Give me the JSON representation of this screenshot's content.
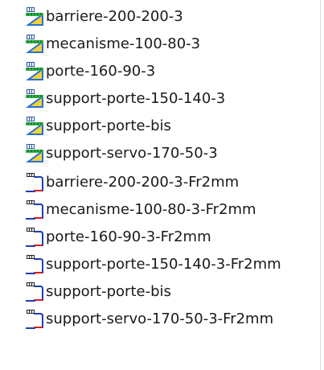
{
  "file_list": {
    "items": [
      {
        "label": "barriere-200-200-3",
        "icon": "part-file-icon"
      },
      {
        "label": "mecanisme-100-80-3",
        "icon": "part-file-icon"
      },
      {
        "label": "porte-160-90-3",
        "icon": "part-file-icon"
      },
      {
        "label": "support-porte-150-140-3",
        "icon": "part-file-icon"
      },
      {
        "label": "support-porte-bis",
        "icon": "part-file-icon"
      },
      {
        "label": "support-servo-170-50-3",
        "icon": "part-file-icon"
      },
      {
        "label": "barriere-200-200-3-Fr2mm",
        "icon": "drawing-file-icon"
      },
      {
        "label": "mecanisme-100-80-3-Fr2mm",
        "icon": "drawing-file-icon"
      },
      {
        "label": "porte-160-90-3-Fr2mm",
        "icon": "drawing-file-icon"
      },
      {
        "label": "support-porte-150-140-3-Fr2mm",
        "icon": "drawing-file-icon"
      },
      {
        "label": "support-porte-bis",
        "icon": "drawing-file-icon"
      },
      {
        "label": "support-servo-170-50-3-Fr2mm",
        "icon": "drawing-file-icon"
      }
    ]
  },
  "colors": {
    "part_icon_blue": "#2a6fd6",
    "part_icon_yellow": "#f2d13a",
    "part_icon_green": "#2fb14a",
    "drawing_icon_blue": "#1d3fb5",
    "drawing_icon_red": "#d61f1f"
  }
}
